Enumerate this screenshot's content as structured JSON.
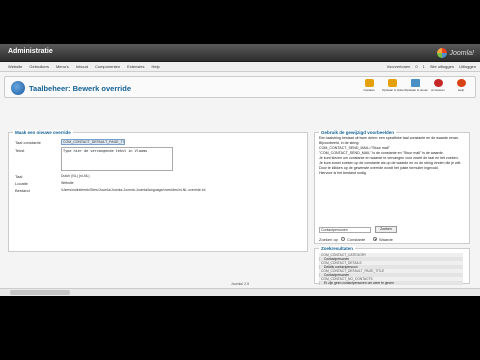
{
  "admin_title": "Administratie",
  "logo_text": "Joomla!",
  "menu": [
    "Website",
    "Gebruikers",
    "Menu's",
    "Inhoud",
    "Componenten",
    "Extensies",
    "Help"
  ],
  "status": [
    "Voorvertonen",
    "0",
    "1",
    "Site uitloggen",
    "Uitloggen"
  ],
  "page_title": "Taalbeheer: Bewerk override",
  "toolbar": {
    "save": "Opslaan",
    "save_close": "Opslaan & sluiten",
    "save_new": "Opslaan & nieuw",
    "cancel": "Annuleren",
    "help": "Help"
  },
  "left": {
    "legend": "Maak een nieuwe override",
    "const_label": "Taal constante",
    "const_value": "COM_CONTACT_DEFAULT_PAGE_TITLE",
    "text_label": "Tekst",
    "text_value": "Type hier de vervangende tekst in Vlaams",
    "taal_label": "Taal",
    "taal_value": "Dutch (NL) (nl-NL)",
    "locatie_label": "Locatie",
    "locatie_value": "Website",
    "bestand_label": "Bestand",
    "bestand_value": "/Users/eulinkfreek/Sites/Joomla/Joomla-Joomla-Joomla/language/overrides/nl-NL.override.ini"
  },
  "right": {
    "legend": "Gebruik de gewijzigd voorbeelden",
    "description": [
      "Een taalstring bestaat uit twee delen: een specifieke taal constante en de waarde ervan.",
      "Bijvoorbeeld, in de string:",
      "COM_CONTACT_SEND_MAIL=\"Stuur mail\"",
      "\"COM_CONTACT_SEND_MAIL\" is de constante en \"Stuur mail\" is de waarde.",
      "Je kunt kiezen om constante en waarde te vervangen voor zowel de taal en het zoeken.",
      "Je kunt zowel zoeken op de constante als op de waarde en zo de string vinden die je wilt.",
      "Door te klikken op de gewenste override wordt het juiste formulier ingevuld.",
      "Hiervoor is het bestand nodig."
    ],
    "search_value": "Contactpersonen",
    "search_button": "Zoeken",
    "zoek_label": "Zoeken op",
    "opt_constant": "Constante",
    "opt_value": "Waarde",
    "results_legend": "Zoekresultaten",
    "results": [
      {
        "key": "COM_CONTACT_CATEGORY",
        "value": "Contactpersonen"
      },
      {
        "key": "COM_CONTACT_DETAILS",
        "value": "Details contactpersoon"
      },
      {
        "key": "COM_CONTACT_DEFAULT_PAGE_TITLE",
        "value": "Contactpersonen"
      },
      {
        "key": "COM_CONTACT_NO_CONTACTS",
        "value": "Er zijn geen contactpersonen om weer te geven"
      }
    ]
  },
  "footer": "Joomla! 2.5"
}
